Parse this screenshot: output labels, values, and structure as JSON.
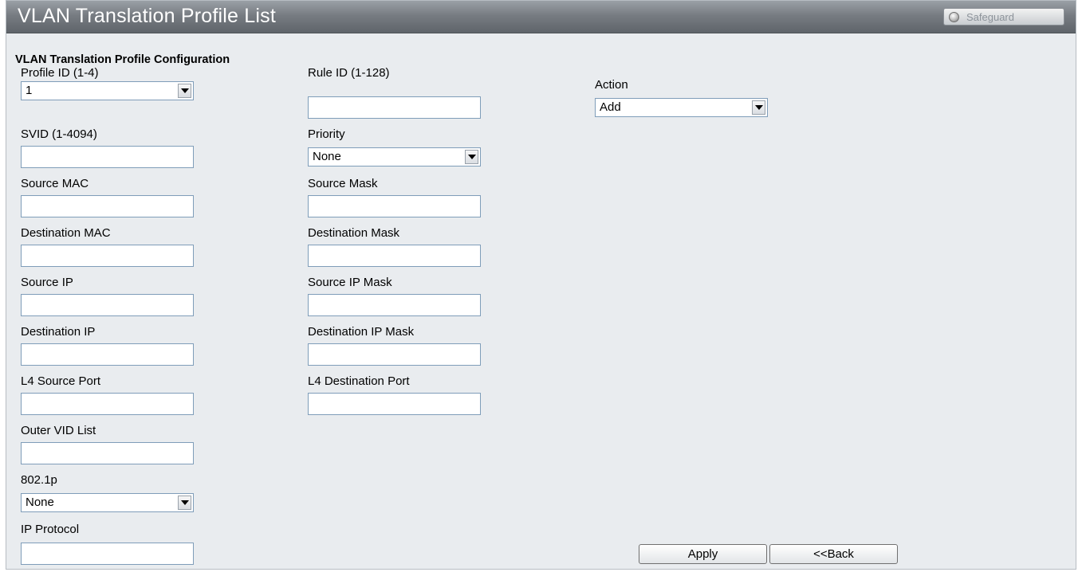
{
  "header": {
    "title": "VLAN Translation Profile List",
    "safeguard_label": "Safeguard"
  },
  "section_title": "VLAN Translation Profile Configuration",
  "fields": {
    "profile_id": {
      "label": "Profile ID (1-4)",
      "value": "1"
    },
    "rule_id": {
      "label": "Rule ID (1-128)",
      "value": ""
    },
    "action": {
      "label": "Action",
      "value": "Add"
    },
    "svid": {
      "label": "SVID (1-4094)",
      "value": ""
    },
    "priority": {
      "label": "Priority",
      "value": "None"
    },
    "source_mac": {
      "label": "Source MAC",
      "value": ""
    },
    "source_mask": {
      "label": "Source Mask",
      "value": ""
    },
    "destination_mac": {
      "label": "Destination MAC",
      "value": ""
    },
    "destination_mask": {
      "label": "Destination Mask",
      "value": ""
    },
    "source_ip": {
      "label": "Source IP",
      "value": ""
    },
    "source_ip_mask": {
      "label": "Source IP Mask",
      "value": ""
    },
    "destination_ip": {
      "label": "Destination IP",
      "value": ""
    },
    "destination_ip_mask": {
      "label": "Destination IP Mask",
      "value": ""
    },
    "l4_source_port": {
      "label": "L4 Source Port",
      "value": ""
    },
    "l4_destination_port": {
      "label": "L4 Destination Port",
      "value": ""
    },
    "outer_vid_list": {
      "label": "Outer VID List",
      "value": ""
    },
    "dot1p": {
      "label": "802.1p",
      "value": "None"
    },
    "ip_protocol": {
      "label": "IP Protocol",
      "value": ""
    }
  },
  "buttons": {
    "apply": "Apply",
    "back": "<<Back"
  },
  "colors": {
    "titlebar": "#777c82",
    "panel_bg": "#e9ecef",
    "input_border": "#7f9db9"
  }
}
